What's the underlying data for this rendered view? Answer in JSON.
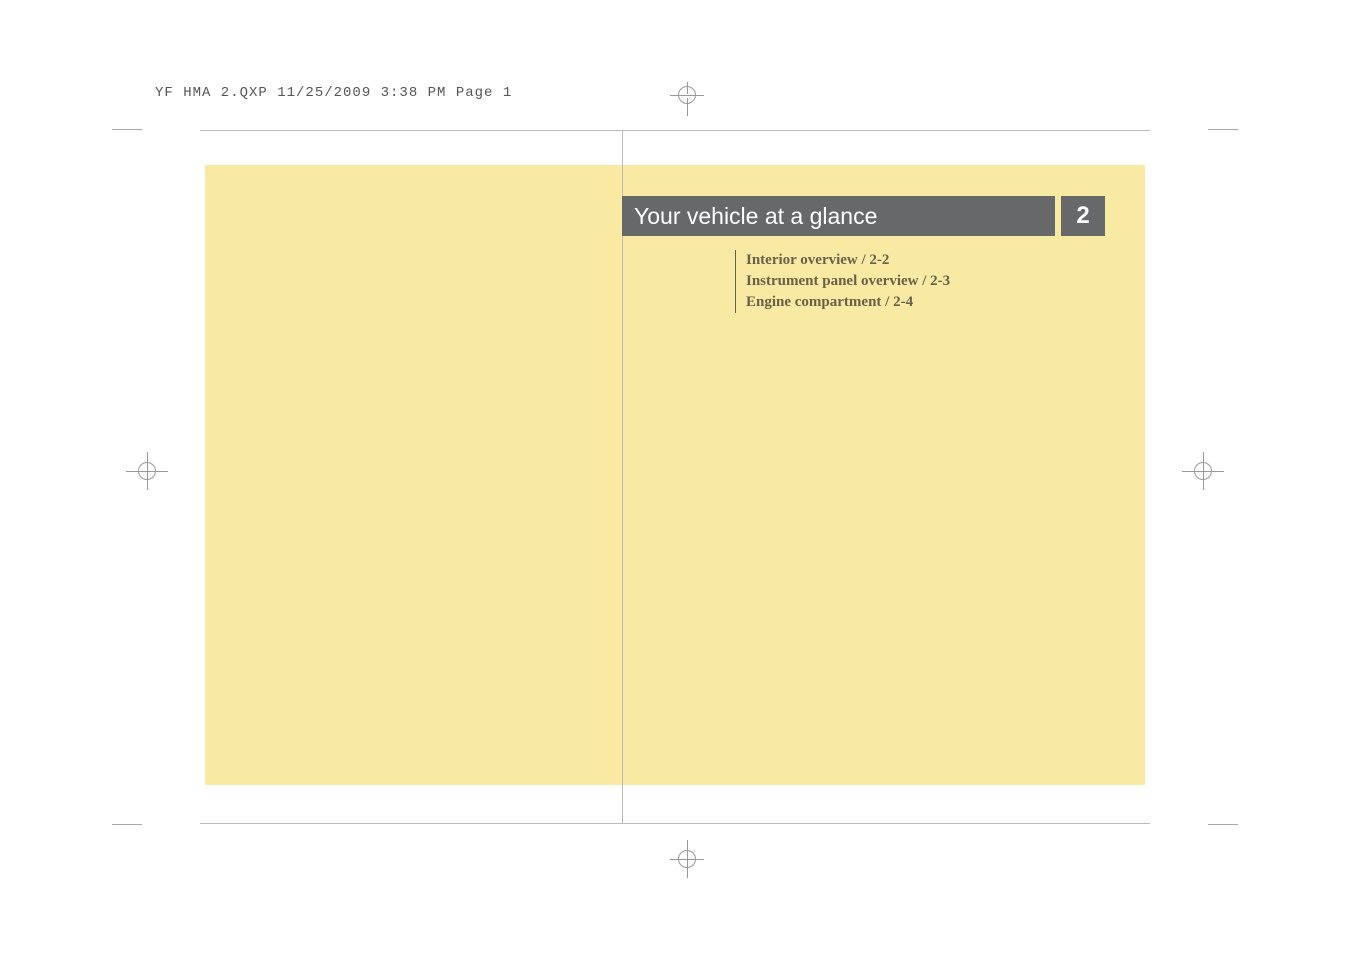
{
  "header": {
    "file_info": "YF HMA 2.QXP  11/25/2009  3:38 PM  Page 1"
  },
  "chapter": {
    "title": "Your vehicle at a glance",
    "number": "2"
  },
  "toc": {
    "items": [
      "Interior overview / 2-2",
      "Instrument panel overview / 2-3",
      "Engine compartment / 2-4"
    ]
  }
}
